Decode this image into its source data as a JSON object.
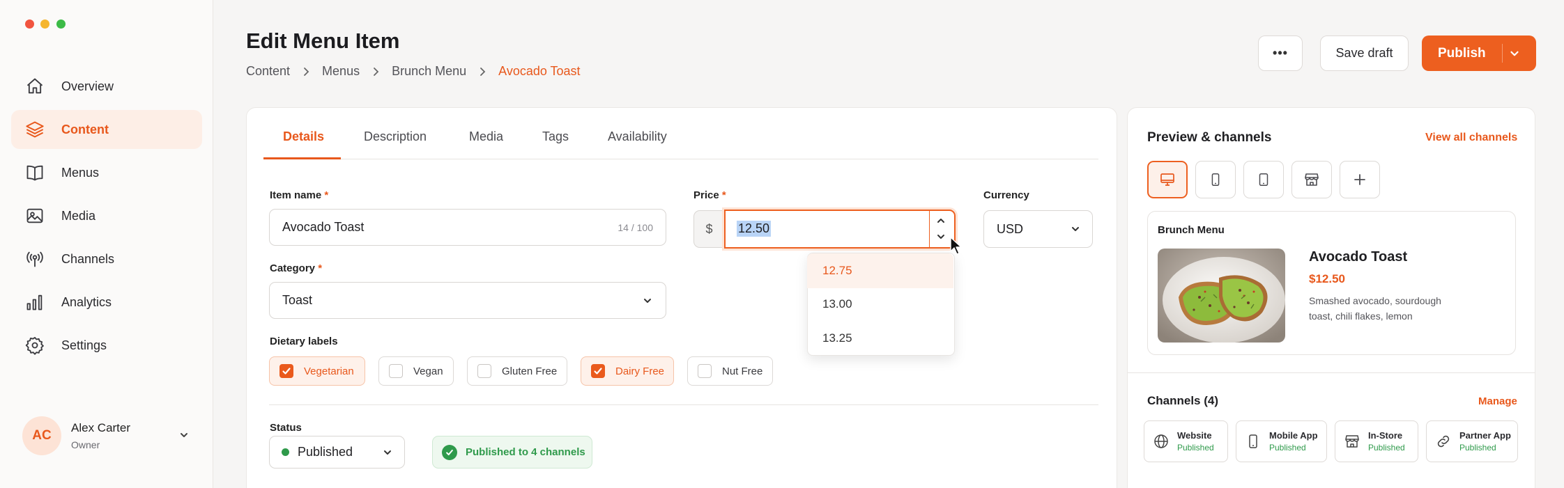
{
  "sidebar": {
    "items": [
      {
        "label": "Overview",
        "icon": "home-icon"
      },
      {
        "label": "Content",
        "icon": "layers-icon",
        "active": true
      },
      {
        "label": "Menus",
        "icon": "book-icon"
      },
      {
        "label": "Media",
        "icon": "image-icon"
      },
      {
        "label": "Channels",
        "icon": "broadcast-icon"
      },
      {
        "label": "Analytics",
        "icon": "bar-chart-icon"
      },
      {
        "label": "Settings",
        "icon": "gear-icon"
      }
    ],
    "user": {
      "initials": "AC",
      "name": "Alex Carter",
      "role": "Owner"
    }
  },
  "header": {
    "title": "Edit Menu Item",
    "breadcrumb": [
      "Content",
      "Menus",
      "Brunch Menu",
      "Avocado Toast"
    ],
    "more_label": "•••",
    "save_draft": "Save draft",
    "publish": "Publish"
  },
  "tabs": [
    "Details",
    "Description",
    "Media",
    "Tags",
    "Availability"
  ],
  "form": {
    "item_name": {
      "label": "Item name",
      "required": "*",
      "value": "Avocado Toast",
      "counter": "14 / 100"
    },
    "price": {
      "label": "Price",
      "required": "*",
      "prefix": "$",
      "value": "12.50",
      "options": [
        "12.75",
        "13.00",
        "13.25"
      ]
    },
    "currency": {
      "label": "Currency",
      "value": "USD"
    },
    "category": {
      "label": "Category",
      "required": "*",
      "value": "Toast"
    },
    "dietary": {
      "label": "Dietary labels",
      "options": [
        {
          "label": "Vegetarian",
          "checked": true
        },
        {
          "label": "Vegan",
          "checked": false
        },
        {
          "label": "Gluten Free",
          "checked": false
        },
        {
          "label": "Dairy Free",
          "checked": true
        },
        {
          "label": "Nut Free",
          "checked": false
        }
      ]
    },
    "status": {
      "label": "Status",
      "value": "Published",
      "badge": "Published to 4 channels"
    }
  },
  "preview": {
    "title": "Preview & channels",
    "view_all": "View all channels",
    "devices": [
      "desktop-icon",
      "mobile-icon",
      "tablet-icon",
      "store-icon",
      "plus-icon"
    ],
    "card": {
      "menu": "Brunch Menu",
      "name": "Avocado Toast",
      "price": "$12.50",
      "description_line1": "Smashed avocado, sourdough",
      "description_line2": "toast, chili flakes, lemon"
    },
    "channels_title": "Channels (4)",
    "manage": "Manage",
    "channels": [
      {
        "name": "Website",
        "status": "Published",
        "icon": "globe-icon"
      },
      {
        "name": "Mobile App",
        "status": "Published",
        "icon": "mobile-icon"
      },
      {
        "name": "In-Store",
        "status": "Published",
        "icon": "store-icon"
      },
      {
        "name": "Partner App",
        "status": "Published",
        "icon": "link-icon"
      }
    ]
  },
  "colors": {
    "accent": "#E8581C",
    "success": "#2F9A4B",
    "text": "#1F1F22"
  }
}
